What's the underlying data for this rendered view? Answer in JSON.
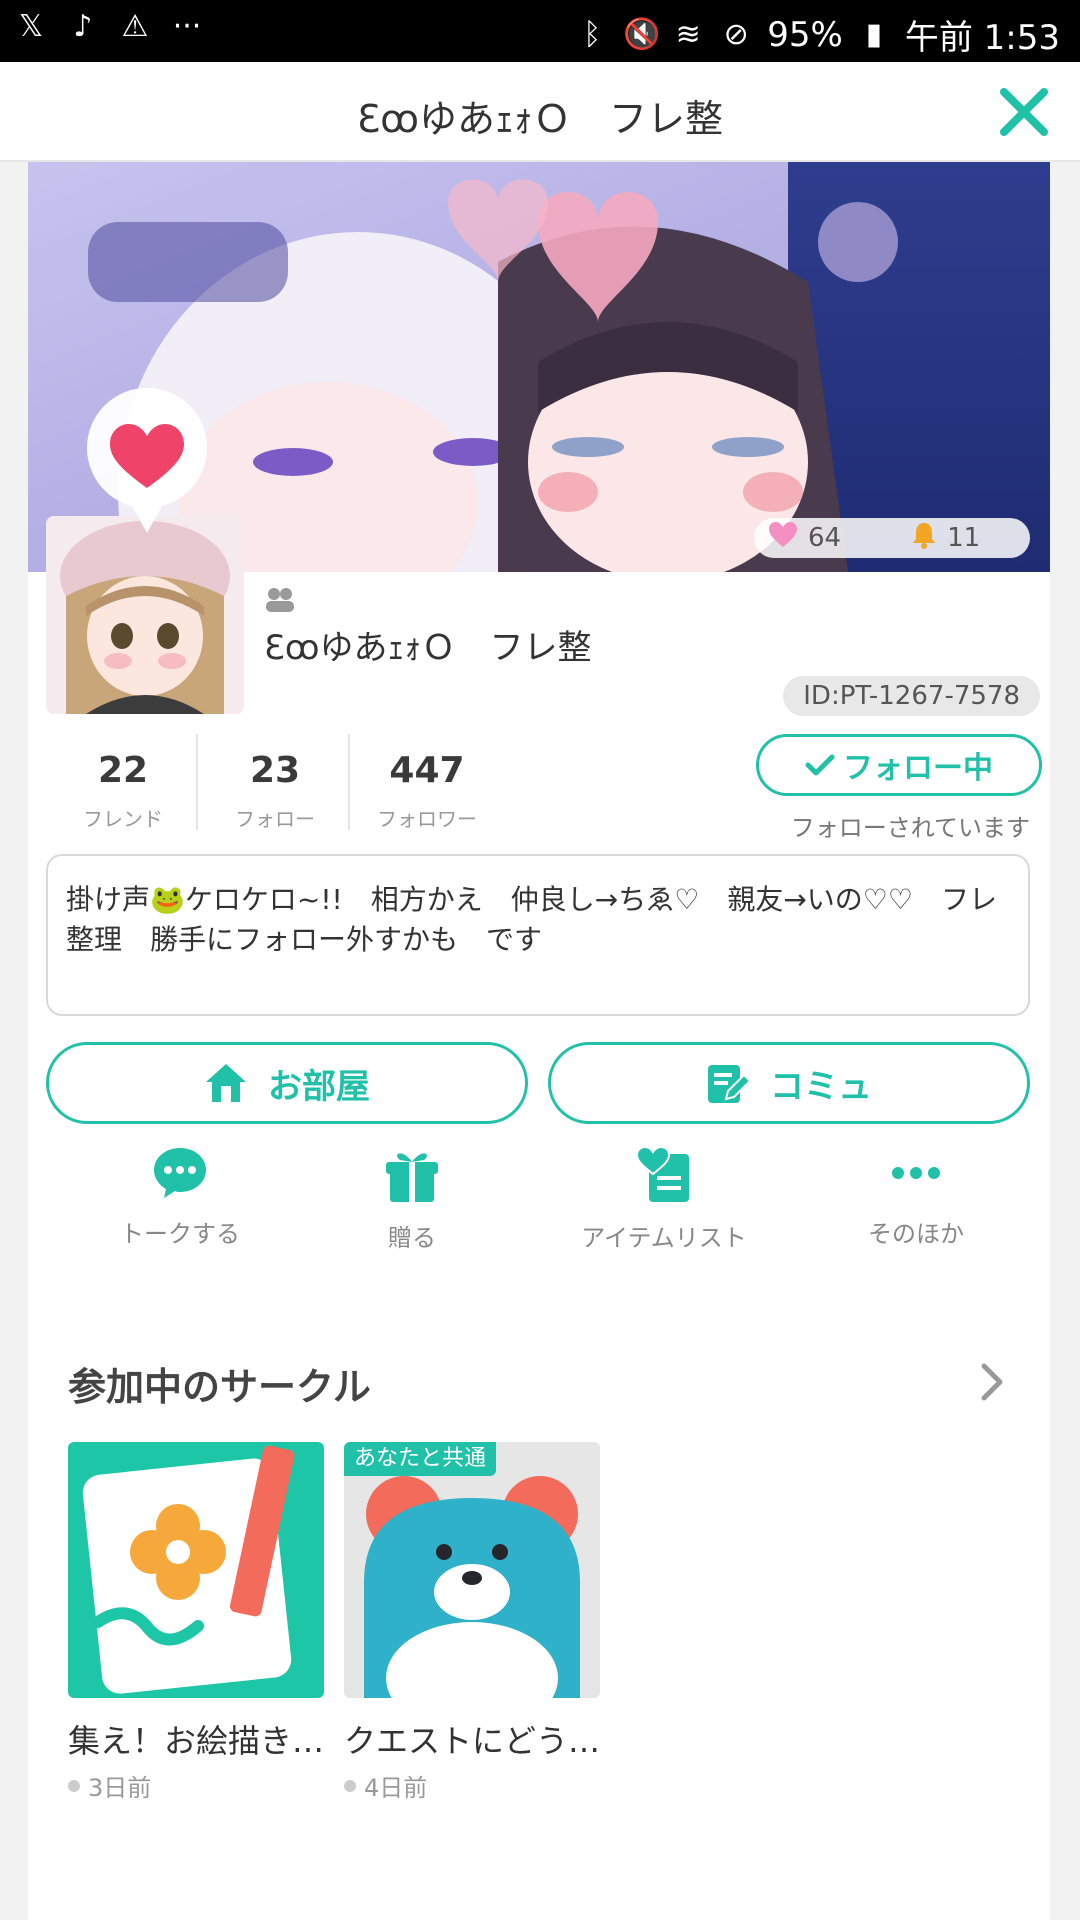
{
  "status_bar": {
    "left_icons": [
      "x-app-icon",
      "tiktok-icon",
      "warning-icon",
      "more-dots-icon"
    ],
    "battery": "95%",
    "time": "午前 1:53"
  },
  "header": {
    "title": "ƐꝏゆあｪｫＯ　フレ整",
    "close_icon": "close-icon"
  },
  "profile": {
    "username": "ƐꝏゆあｪｫＯ　フレ整",
    "id": "ID:PT-1267-7578",
    "likes": "64",
    "notifications": "11",
    "stats": [
      {
        "num": "22",
        "label": "フレンド"
      },
      {
        "num": "23",
        "label": "フォロー"
      },
      {
        "num": "447",
        "label": "フォロワー"
      }
    ],
    "follow_button": "フォロー中",
    "followed_text": "フォローされています",
    "bio": "掛け声🐸ケロケロ~!!　相方かえ　仲良し→ちゑ♡　親友→いの♡♡　フレ整理　勝手にフォロー外すかも　です"
  },
  "actions": {
    "room": "お部屋",
    "community": "コミュ"
  },
  "quick_actions": [
    {
      "label": "トークする",
      "icon": "chat-bubble-icon"
    },
    {
      "label": "贈る",
      "icon": "gift-icon"
    },
    {
      "label": "アイテムリスト",
      "icon": "item-list-icon"
    },
    {
      "label": "そのほか",
      "icon": "more-icon"
    }
  ],
  "circles": {
    "title": "参加中のサークル",
    "items": [
      {
        "name": "集え！お絵描き…",
        "time": "3日前",
        "badge": ""
      },
      {
        "name": "クエストにどう…",
        "time": "4日前",
        "badge": "あなたと共通"
      }
    ]
  },
  "colors": {
    "accent": "#21c0a8",
    "heart": "#f0436a",
    "bell": "#f2a623"
  }
}
